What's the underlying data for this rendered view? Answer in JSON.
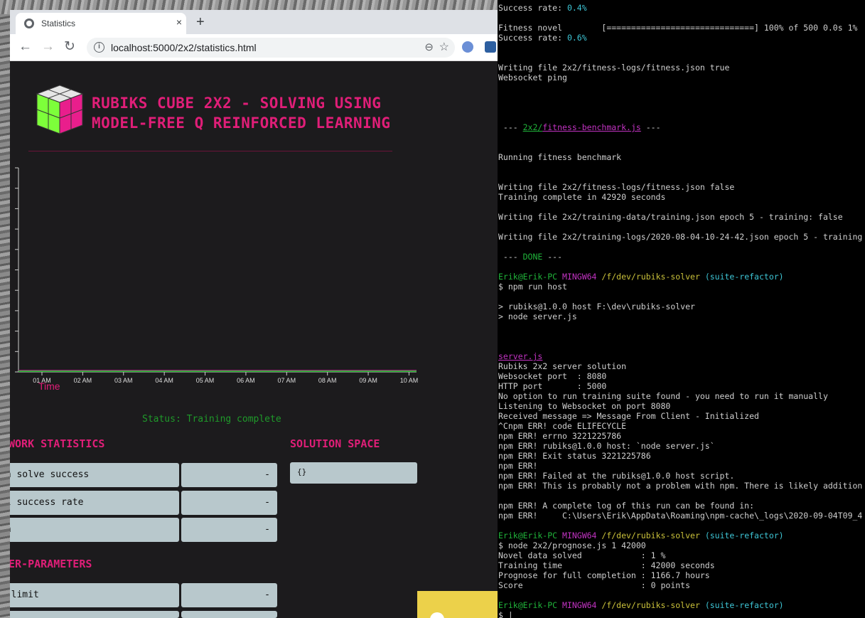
{
  "browser": {
    "tab_title": "Statistics",
    "tab_close": "×",
    "new_tab": "+",
    "back": "←",
    "forward": "→",
    "reload": "↻",
    "url": "localhost:5000/2x2/statistics.html",
    "info_icon": "i",
    "zoom_icon": "⊖",
    "star_icon": "☆"
  },
  "page": {
    "title": "RUBIKS CUBE 2X2 - SOLVING USING MODEL-FREE Q REINFORCED LEARNING",
    "status": "Status: Training complete",
    "chart_xlabel": "Time",
    "network_statistics_title": "WORK STATISTICS",
    "network_rows": [
      {
        "label": "ch solve success",
        "value": "-"
      },
      {
        "label": "al success rate",
        "value": "-"
      },
      {
        "label": "ch",
        "value": "-"
      }
    ],
    "solution_space_title": "SOLUTION SPACE",
    "solution_space_value": "{}",
    "hyper_parameters_title": "ER-PARAMETERS",
    "hyper_rows": [
      {
        "label": "e limit",
        "value": "-"
      }
    ],
    "colors": {
      "accent": "#e01e78",
      "status": "#1f9a2a",
      "row_bg": "#b8c8cc",
      "page_bg": "#1c1b1d"
    }
  },
  "chart_data": {
    "type": "line",
    "xlabel": "Time",
    "ylabel": "",
    "x": [
      "01 AM",
      "02 AM",
      "03 AM",
      "04 AM",
      "05 AM",
      "06 AM",
      "07 AM",
      "08 AM",
      "09 AM",
      "10 AM"
    ],
    "series": [
      {
        "color": "#9e1f7a",
        "values": [
          0,
          0,
          0,
          0,
          0,
          0,
          0,
          0,
          0,
          0
        ]
      },
      {
        "color": "#37a53b",
        "values": [
          0,
          0,
          0,
          0,
          0,
          0,
          0,
          0,
          0,
          0
        ]
      }
    ],
    "grid": false
  },
  "terminal": {
    "lines": [
      [
        {
          "t": "Success rate: "
        },
        {
          "t": "0.4%",
          "c": "cy"
        }
      ],
      [
        {
          "t": ""
        }
      ],
      [
        {
          "t": "Fitness novel        [==============================] 100% of 500 0.0s 1%"
        }
      ],
      [
        {
          "t": "Success rate: "
        },
        {
          "t": "0.6%",
          "c": "cy"
        }
      ],
      [
        {
          "t": ""
        }
      ],
      [
        {
          "t": ""
        }
      ],
      [
        {
          "t": "Writing file 2x2/fitness-logs/fitness.json true"
        }
      ],
      [
        {
          "t": "Websocket ping"
        }
      ],
      [
        {
          "t": ""
        }
      ],
      [
        {
          "t": ""
        }
      ],
      [
        {
          "t": ""
        }
      ],
      [
        {
          "t": ""
        }
      ],
      [
        {
          "t": " --- "
        },
        {
          "t": "2x2/",
          "c": "gr ul"
        },
        {
          "t": "fitness-benchmark.js",
          "c": "mg ul"
        },
        {
          "t": " ---"
        }
      ],
      [
        {
          "t": ""
        }
      ],
      [
        {
          "t": ""
        }
      ],
      [
        {
          "t": "Running fitness benchmark"
        }
      ],
      [
        {
          "t": ""
        }
      ],
      [
        {
          "t": ""
        }
      ],
      [
        {
          "t": "Writing file 2x2/fitness-logs/fitness.json false"
        }
      ],
      [
        {
          "t": "Training complete in 42920 seconds"
        }
      ],
      [
        {
          "t": ""
        }
      ],
      [
        {
          "t": "Writing file 2x2/training-data/training.json epoch 5 - training: false"
        }
      ],
      [
        {
          "t": ""
        }
      ],
      [
        {
          "t": "Writing file 2x2/training-logs/2020-08-04-10-24-42.json epoch 5 - training"
        }
      ],
      [
        {
          "t": ""
        }
      ],
      [
        {
          "t": " --- "
        },
        {
          "t": "DONE",
          "c": "gr"
        },
        {
          "t": " ---"
        }
      ],
      [
        {
          "t": ""
        }
      ],
      [
        {
          "t": "Erik@Erik-PC ",
          "c": "gr"
        },
        {
          "t": "MINGW64 ",
          "c": "mg"
        },
        {
          "t": "/f/dev/rubiks-solver ",
          "c": "yl"
        },
        {
          "t": "(suite-refactor)",
          "c": "cy"
        }
      ],
      [
        {
          "t": "$ npm run host"
        }
      ],
      [
        {
          "t": ""
        }
      ],
      [
        {
          "t": "> rubiks@1.0.0 host F:\\dev\\rubiks-solver"
        }
      ],
      [
        {
          "t": "> node server.js"
        }
      ],
      [
        {
          "t": ""
        }
      ],
      [
        {
          "t": ""
        }
      ],
      [
        {
          "t": ""
        }
      ],
      [
        {
          "t": "server.js",
          "c": "mg ul"
        }
      ],
      [
        {
          "t": "Rubiks 2x2 server solution"
        }
      ],
      [
        {
          "t": "Websocket port  : 8080"
        }
      ],
      [
        {
          "t": "HTTP port       : 5000"
        }
      ],
      [
        {
          "t": "No option to run training suite found - you need to run it manually"
        }
      ],
      [
        {
          "t": "Listening to Websocket on port 8080"
        }
      ],
      [
        {
          "t": "Received message => Message From Client - Initialized"
        }
      ],
      [
        {
          "t": "^Cnpm ERR! code ELIFECYCLE"
        }
      ],
      [
        {
          "t": "npm ERR! errno 3221225786"
        }
      ],
      [
        {
          "t": "npm ERR! rubiks@1.0.0 host: `node server.js`"
        }
      ],
      [
        {
          "t": "npm ERR! Exit status 3221225786"
        }
      ],
      [
        {
          "t": "npm ERR!"
        }
      ],
      [
        {
          "t": "npm ERR! Failed at the rubiks@1.0.0 host script."
        }
      ],
      [
        {
          "t": "npm ERR! This is probably not a problem with npm. There is likely addition"
        }
      ],
      [
        {
          "t": ""
        }
      ],
      [
        {
          "t": "npm ERR! A complete log of this run can be found in:"
        }
      ],
      [
        {
          "t": "npm ERR!     C:\\Users\\Erik\\AppData\\Roaming\\npm-cache\\_logs\\2020-09-04T09_4"
        }
      ],
      [
        {
          "t": ""
        }
      ],
      [
        {
          "t": "Erik@Erik-PC ",
          "c": "gr"
        },
        {
          "t": "MINGW64 ",
          "c": "mg"
        },
        {
          "t": "/f/dev/rubiks-solver ",
          "c": "yl"
        },
        {
          "t": "(suite-refactor)",
          "c": "cy"
        }
      ],
      [
        {
          "t": "$ node 2x2/prognose.js 1 42000"
        }
      ],
      [
        {
          "t": "Novel data solved            : 1 %"
        }
      ],
      [
        {
          "t": "Training time                : 42000 seconds"
        }
      ],
      [
        {
          "t": "Prognose for full completion : 1166.7 hours"
        }
      ],
      [
        {
          "t": "Score                        : 0 points"
        }
      ],
      [
        {
          "t": ""
        }
      ],
      [
        {
          "t": "Erik@Erik-PC ",
          "c": "gr"
        },
        {
          "t": "MINGW64 ",
          "c": "mg"
        },
        {
          "t": "/f/dev/rubiks-solver ",
          "c": "yl"
        },
        {
          "t": "(suite-refactor)",
          "c": "cy"
        }
      ],
      [
        {
          "t": "$ |"
        }
      ]
    ]
  }
}
